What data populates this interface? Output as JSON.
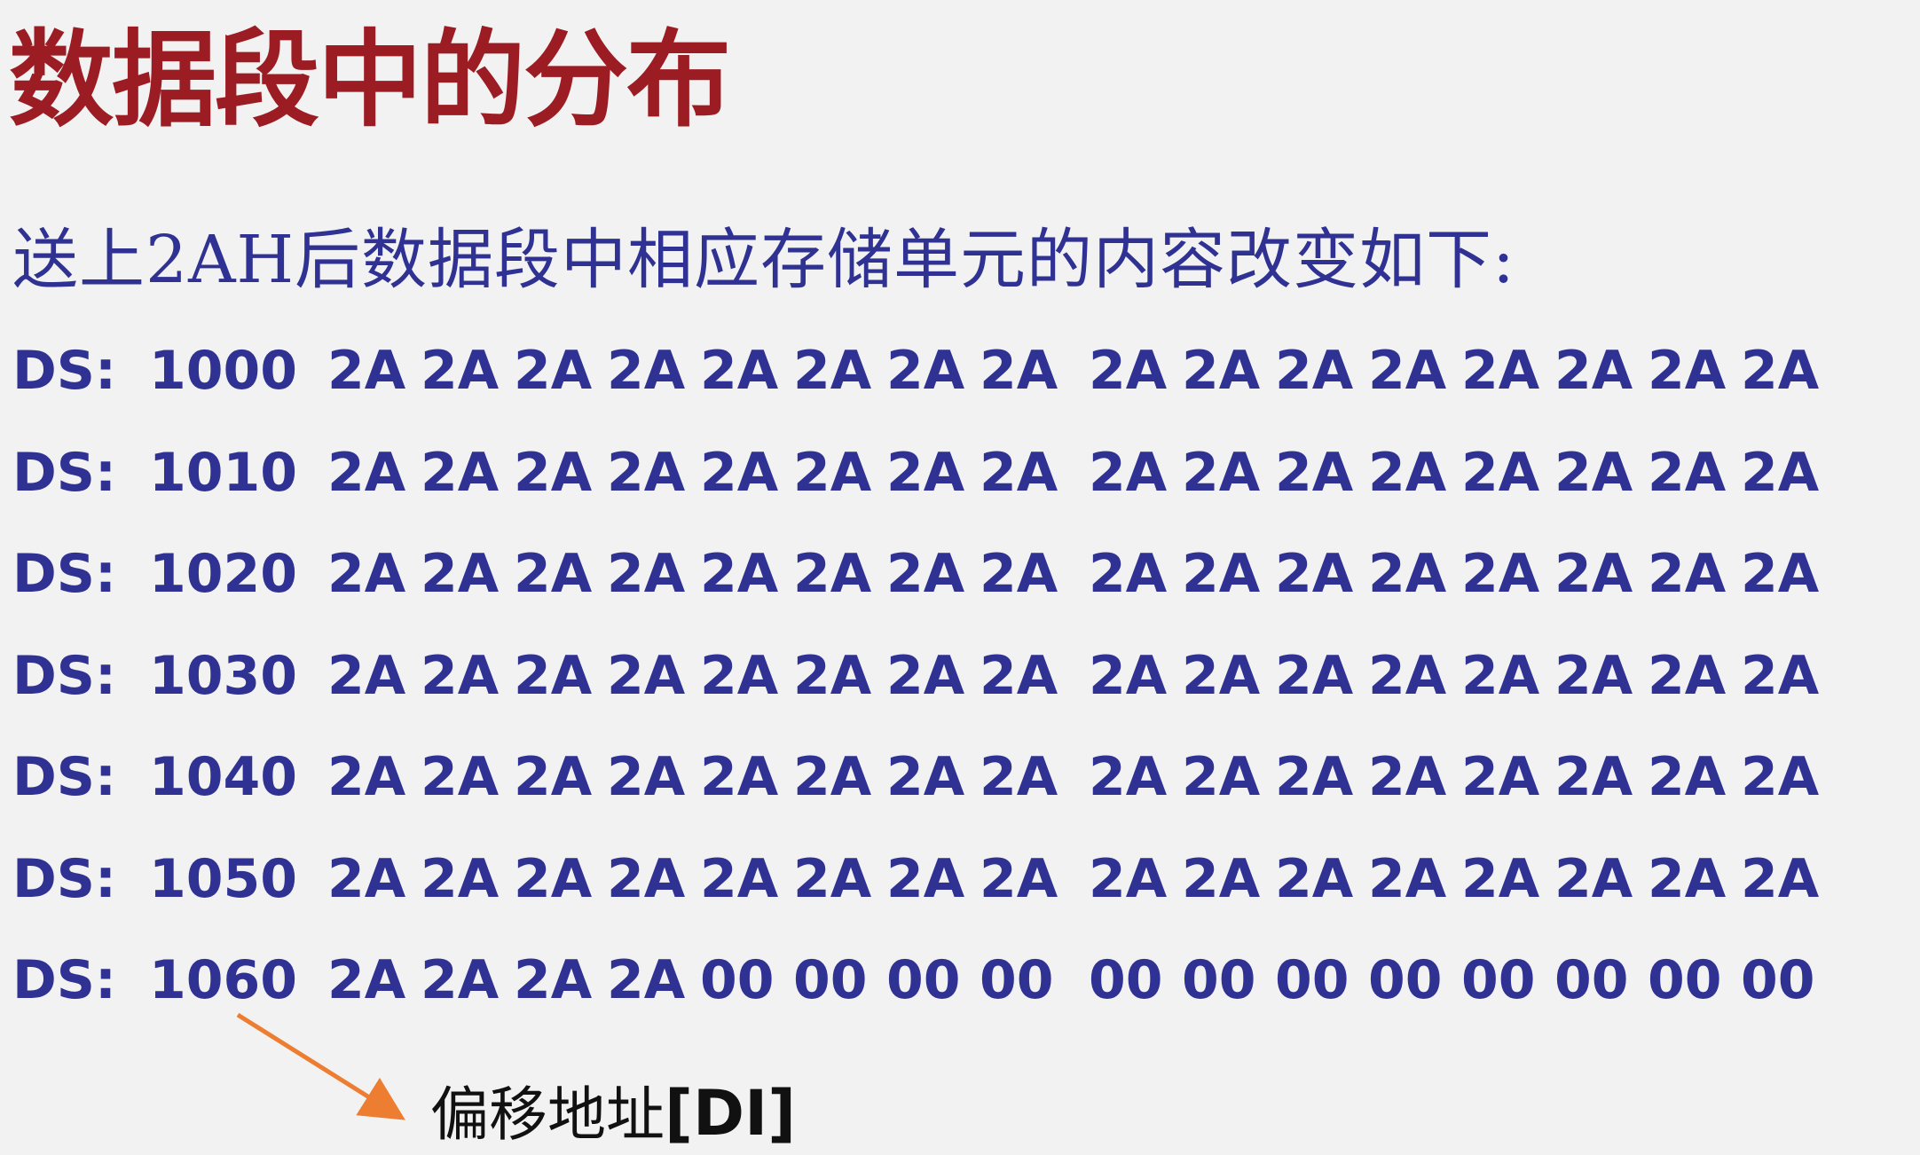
{
  "title": "数据段中的分布",
  "subtitle": "送上2AH后数据段中相应存储单元的内容改变如下:",
  "segment_prefix": "DS:",
  "rows": [
    {
      "addr": "1000",
      "bytes": [
        "2A",
        "2A",
        "2A",
        "2A",
        "2A",
        "2A",
        "2A",
        "2A",
        "2A",
        "2A",
        "2A",
        "2A",
        "2A",
        "2A",
        "2A",
        "2A"
      ]
    },
    {
      "addr": "1010",
      "bytes": [
        "2A",
        "2A",
        "2A",
        "2A",
        "2A",
        "2A",
        "2A",
        "2A",
        "2A",
        "2A",
        "2A",
        "2A",
        "2A",
        "2A",
        "2A",
        "2A"
      ]
    },
    {
      "addr": "1020",
      "bytes": [
        "2A",
        "2A",
        "2A",
        "2A",
        "2A",
        "2A",
        "2A",
        "2A",
        "2A",
        "2A",
        "2A",
        "2A",
        "2A",
        "2A",
        "2A",
        "2A"
      ]
    },
    {
      "addr": "1030",
      "bytes": [
        "2A",
        "2A",
        "2A",
        "2A",
        "2A",
        "2A",
        "2A",
        "2A",
        "2A",
        "2A",
        "2A",
        "2A",
        "2A",
        "2A",
        "2A",
        "2A"
      ]
    },
    {
      "addr": "1040",
      "bytes": [
        "2A",
        "2A",
        "2A",
        "2A",
        "2A",
        "2A",
        "2A",
        "2A",
        "2A",
        "2A",
        "2A",
        "2A",
        "2A",
        "2A",
        "2A",
        "2A"
      ]
    },
    {
      "addr": "1050",
      "bytes": [
        "2A",
        "2A",
        "2A",
        "2A",
        "2A",
        "2A",
        "2A",
        "2A",
        "2A",
        "2A",
        "2A",
        "2A",
        "2A",
        "2A",
        "2A",
        "2A"
      ]
    },
    {
      "addr": "1060",
      "bytes": [
        "2A",
        "2A",
        "2A",
        "2A",
        "00",
        "00",
        "00",
        "00",
        "00",
        "00",
        "00",
        "00",
        "00",
        "00",
        "00",
        "00"
      ]
    }
  ],
  "annotation": {
    "label_cn": "偏移地址",
    "label_reg": "[DI]",
    "arrow_color": "#ed7d31"
  }
}
